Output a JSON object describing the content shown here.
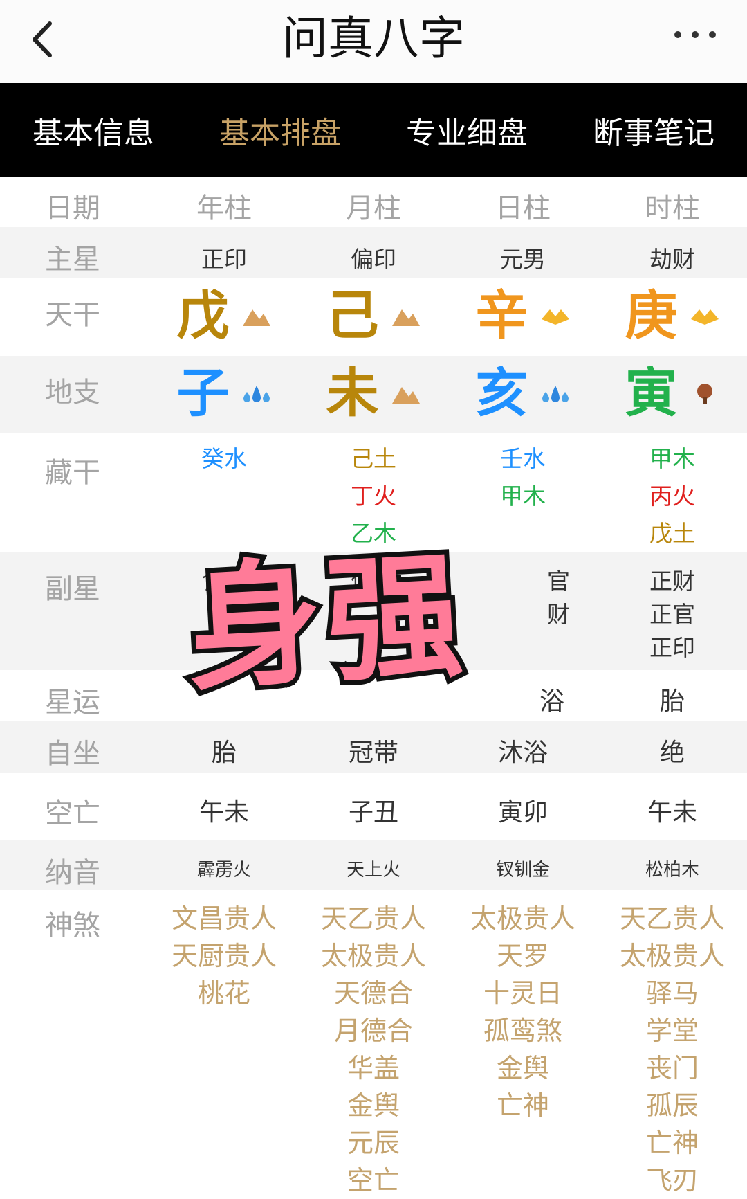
{
  "header": {
    "title": "问真八字"
  },
  "tabs": [
    {
      "label": "基本信息"
    },
    {
      "label": "基本排盘",
      "active": true
    },
    {
      "label": "专业细盘"
    },
    {
      "label": "断事笔记"
    }
  ],
  "labels": {
    "date": "日期",
    "main_star": "主星",
    "tiangan": "天干",
    "dizhi": "地支",
    "canggan": "藏干",
    "fuxing": "副星",
    "xingyun": "星运",
    "zizuo": "自坐",
    "kongwang": "空亡",
    "nayin": "纳音",
    "shensha": "神煞"
  },
  "columns": [
    "年柱",
    "月柱",
    "日柱",
    "时柱"
  ],
  "main_star": [
    "正印",
    "偏印",
    "元男",
    "劫财"
  ],
  "tiangan": [
    {
      "char": "戊",
      "color": "#b8860b",
      "icon": "mountain-icon"
    },
    {
      "char": "己",
      "color": "#b8860b",
      "icon": "mountain-icon"
    },
    {
      "char": "辛",
      "color": "#f0961e",
      "icon": "gold-icon"
    },
    {
      "char": "庚",
      "color": "#f0961e",
      "icon": "gold-icon"
    }
  ],
  "dizhi": [
    {
      "char": "子",
      "color": "#1e90ff",
      "icon": "water-drops-icon"
    },
    {
      "char": "未",
      "color": "#b8860b",
      "icon": "mountain-icon"
    },
    {
      "char": "亥",
      "color": "#1e90ff",
      "icon": "water-drops-icon"
    },
    {
      "char": "寅",
      "color": "#22b14c",
      "icon": "tree-icon"
    }
  ],
  "canggan": [
    [
      {
        "text": "癸水",
        "color": "#1e90ff"
      }
    ],
    [
      {
        "text": "己土",
        "color": "#b8860b"
      },
      {
        "text": "丁火",
        "color": "#e0201e"
      },
      {
        "text": "乙木",
        "color": "#22b14c"
      }
    ],
    [
      {
        "text": "壬水",
        "color": "#1e90ff"
      },
      {
        "text": "甲木",
        "color": "#22b14c"
      }
    ],
    [
      {
        "text": "甲木",
        "color": "#22b14c"
      },
      {
        "text": "丙火",
        "color": "#e0201e"
      },
      {
        "text": "戊土",
        "color": "#b8860b"
      }
    ]
  ],
  "fuxing": [
    [
      "食神"
    ],
    [
      "偏印"
    ],
    [
      "官",
      "财"
    ],
    [
      "正财",
      "正官",
      "正印"
    ]
  ],
  "xingyun": [
    "",
    "",
    "浴",
    "胎"
  ],
  "zizuo": [
    "胎",
    "冠带",
    "沐浴",
    "绝"
  ],
  "kongwang": [
    "午未",
    "子丑",
    "寅卯",
    "午未"
  ],
  "nayin": [
    "霹雳火",
    "天上火",
    "钗钏金",
    "松柏木"
  ],
  "shensha": [
    [
      "文昌贵人",
      "天厨贵人",
      "桃花"
    ],
    [
      "天乙贵人",
      "太极贵人",
      "天德合",
      "月德合",
      "华盖",
      "金舆",
      "元辰",
      "空亡"
    ],
    [
      "太极贵人",
      "天罗",
      "十灵日",
      "孤鸾煞",
      "金舆",
      "亡神"
    ],
    [
      "天乙贵人",
      "太极贵人",
      "驿马",
      "学堂",
      "丧门",
      "孤辰",
      "亡神",
      "飞刃"
    ]
  ],
  "overlay": {
    "text": "身强",
    "color": "#ff7b98"
  }
}
